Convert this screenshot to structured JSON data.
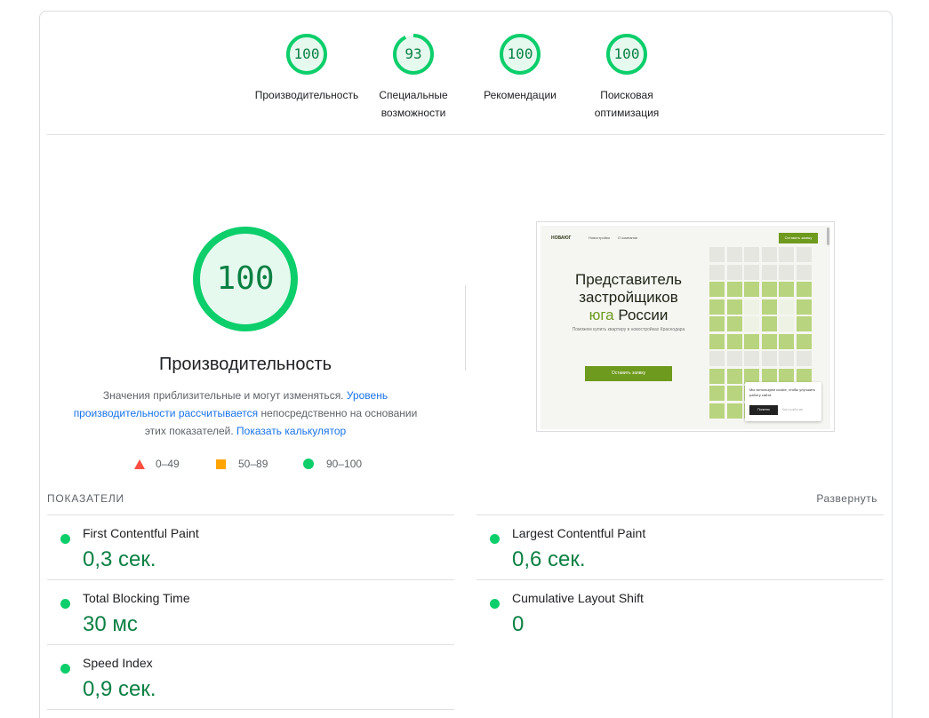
{
  "colors": {
    "pass": "#0cce6b",
    "pass_text": "#0b8043",
    "average": "#ffa400",
    "fail": "#ff4e42",
    "link": "#1a73e8"
  },
  "categories": [
    {
      "score": "100",
      "label": "Производительность"
    },
    {
      "score": "93",
      "label": "Специальные возможности"
    },
    {
      "score": "100",
      "label": "Рекомендации"
    },
    {
      "score": "100",
      "label": "Поисковая оптимизация"
    }
  ],
  "performance": {
    "score": "100",
    "title": "Производительность",
    "desc_prefix": "Значения приблизительные и могут изменяться.",
    "desc_link1": "Уровень производительности рассчитывается",
    "desc_middle": "непосредственно на основании этих показателей.",
    "desc_link2": "Показать калькулятор"
  },
  "legend": {
    "fail": "0–49",
    "average": "50–89",
    "pass": "90–100"
  },
  "screenshot": {
    "logo": "НОВАЮГ",
    "nav": [
      "Новостройки",
      "О компании"
    ],
    "cta_top": "Оставить заявку",
    "headline_1": "Представитель",
    "headline_2": "застройщиков",
    "headline_accent": "юга",
    "headline_3": "России",
    "sub": "Поможем купить квартиру в новостройках Краснодара",
    "cta": "Оставить заявку",
    "cookie_text": "Мы используем cookie, чтобы улучшить работу сайта",
    "cookie_button": "Понятно",
    "cookie_link": "Как я работаю"
  },
  "metrics": {
    "header": "ПОКАЗАТЕЛИ",
    "expand": "Развернуть",
    "items": [
      {
        "name": "First Contentful Paint",
        "value": "0,3 сек."
      },
      {
        "name": "Largest Contentful Paint",
        "value": "0,6 сек."
      },
      {
        "name": "Total Blocking Time",
        "value": "30 мс"
      },
      {
        "name": "Cumulative Layout Shift",
        "value": "0"
      },
      {
        "name": "Speed Index",
        "value": "0,9 сек."
      }
    ]
  }
}
